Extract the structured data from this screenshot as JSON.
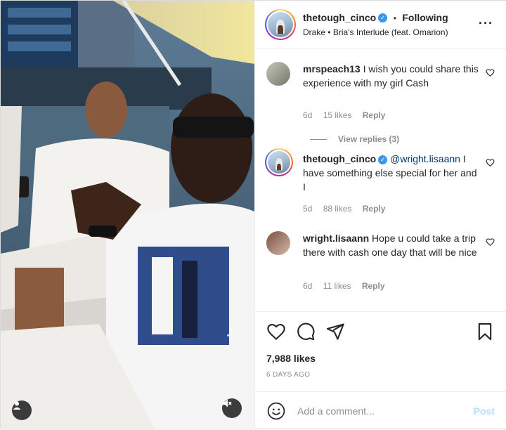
{
  "post": {
    "username": "thetough_cinco",
    "follow_label": "Following",
    "song": "Drake • Bria's Interlude (feat. Omarion)",
    "more_icon": "more-options-icon"
  },
  "comments": [
    {
      "username": "mrspeach13",
      "text": "I wish you could share this experience with my girl Cash",
      "age": "6d",
      "likes": "15 likes",
      "reply": "Reply",
      "view_replies": "View replies (3)"
    },
    {
      "username": "thetough_cinco",
      "verified": true,
      "mention": "@wright.lisaann",
      "text": "I have something else special for her and I",
      "age": "5d",
      "likes": "88 likes",
      "reply": "Reply"
    },
    {
      "username": "wright.lisaann",
      "text": "Hope u could take a trip there with cash one day that will be nice",
      "age": "6d",
      "likes": "11 likes",
      "reply": "Reply"
    }
  ],
  "actions": {
    "like_icon": "heart-icon",
    "comment_icon": "comment-icon",
    "share_icon": "share-icon",
    "save_icon": "bookmark-icon",
    "likes": "7,988 likes",
    "time_ago": "6 DAYS AGO"
  },
  "composer": {
    "placeholder": "Add a comment...",
    "post_label": "Post"
  },
  "colors": {
    "accent": "#3897f0",
    "post_disabled": "#b2dffc",
    "muted": "#8e8e8e"
  }
}
